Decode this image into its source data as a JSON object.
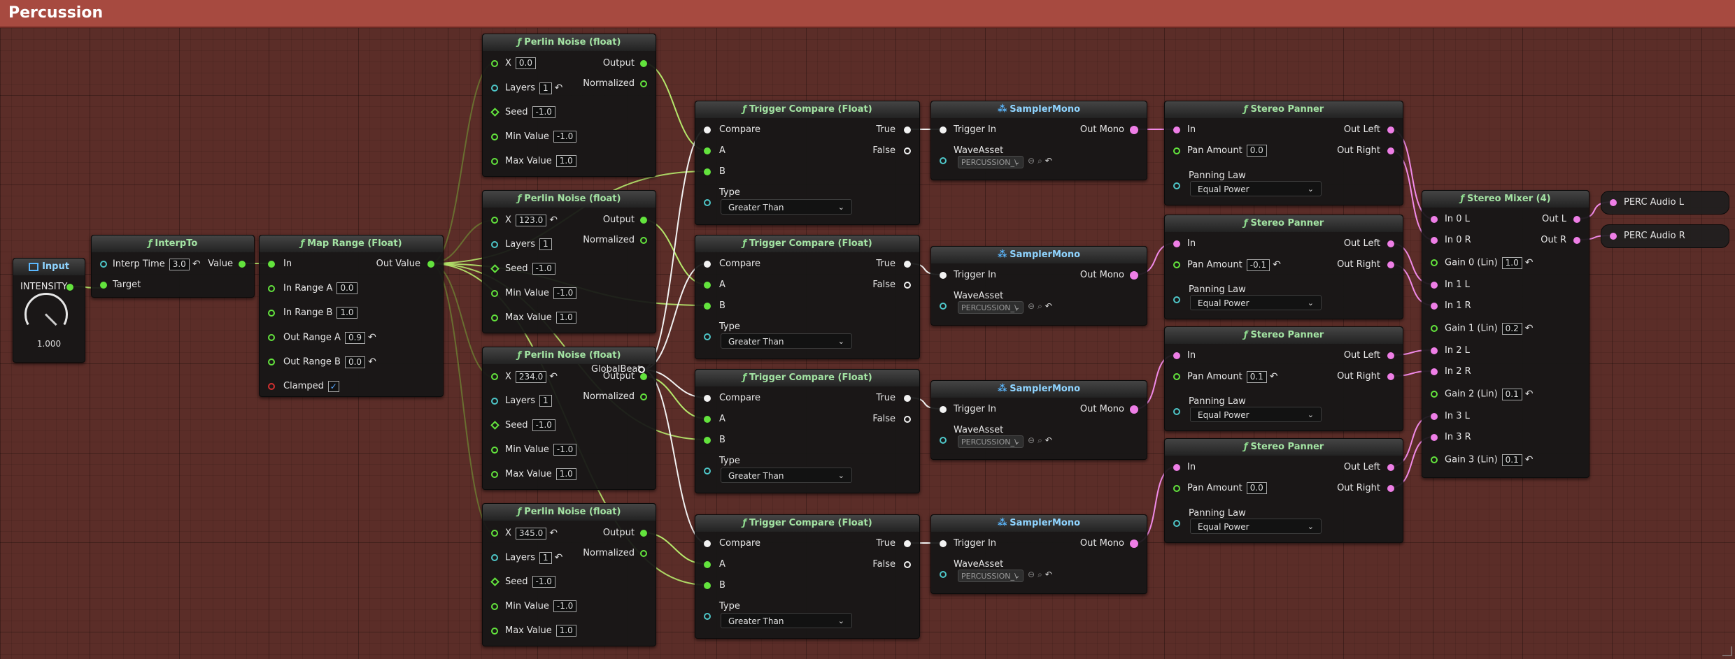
{
  "graph_title": "Percussion",
  "colors": {
    "title_bar": "#a74a40",
    "background": "#5b2d28",
    "float_pin": "#63e33d",
    "audio_pin": "#ee7ee6",
    "trigger_pin": "#f2f2f2"
  },
  "input_node": {
    "title": "Input",
    "pin_label": "INTENSITY",
    "knob_value": "1.000"
  },
  "interp_node": {
    "title": "InterpTo",
    "interp_time_label": "Interp Time",
    "interp_time_value": "3.0",
    "target_label": "Target",
    "value_label": "Value"
  },
  "map_range_node": {
    "title": "Map Range (Float)",
    "in_label": "In",
    "out_label": "Out Value",
    "in_range_a_label": "In Range A",
    "in_range_a": "0.0",
    "in_range_b_label": "In Range B",
    "in_range_b": "1.0",
    "out_range_a_label": "Out Range A",
    "out_range_a": "0.9",
    "out_range_b_label": "Out Range B",
    "out_range_b": "0.0",
    "clamped_label": "Clamped",
    "clamped_check": "✓"
  },
  "perlin_nodes": [
    {
      "title": "Perlin Noise (float)",
      "x_label": "X",
      "x": "0.0",
      "layers_label": "Layers",
      "layers": "1",
      "seed_label": "Seed",
      "seed": "-1.0",
      "min_label": "Min Value",
      "min": "-1.0",
      "max_label": "Max Value",
      "max": "1.0",
      "output_label": "Output",
      "normalized_label": "Normalized"
    },
    {
      "title": "Perlin Noise (float)",
      "x_label": "X",
      "x": "123.0",
      "layers_label": "Layers",
      "layers": "1",
      "seed_label": "Seed",
      "seed": "-1.0",
      "min_label": "Min Value",
      "min": "-1.0",
      "max_label": "Max Value",
      "max": "1.0",
      "output_label": "Output",
      "normalized_label": "Normalized"
    },
    {
      "title": "Perlin Noise (float)",
      "x_label": "X",
      "x": "234.0",
      "layers_label": "Layers",
      "layers": "1",
      "seed_label": "Seed",
      "seed": "-1.0",
      "min_label": "Min Value",
      "min": "-1.0",
      "max_label": "Max Value",
      "max": "1.0",
      "output_label": "Output",
      "normalized_label": "Normalized"
    },
    {
      "title": "Perlin Noise (float)",
      "x_label": "X",
      "x": "345.0",
      "layers_label": "Layers",
      "layers": "1",
      "seed_label": "Seed",
      "seed": "-1.0",
      "min_label": "Min Value",
      "min": "-1.0",
      "max_label": "Max Value",
      "max": "1.0",
      "output_label": "Output",
      "normalized_label": "Normalized"
    }
  ],
  "global_beat_label": "GlobalBeat",
  "trigger_nodes": [
    {
      "title": "Trigger Compare (Float)",
      "compare_label": "Compare",
      "a_label": "A",
      "b_label": "B",
      "type_label": "Type",
      "type_value": "Greater Than",
      "true_label": "True",
      "false_label": "False"
    },
    {
      "title": "Trigger Compare (Float)",
      "compare_label": "Compare",
      "a_label": "A",
      "b_label": "B",
      "type_label": "Type",
      "type_value": "Greater Than",
      "true_label": "True",
      "false_label": "False"
    },
    {
      "title": "Trigger Compare (Float)",
      "compare_label": "Compare",
      "a_label": "A",
      "b_label": "B",
      "type_label": "Type",
      "type_value": "Greater Than",
      "true_label": "True",
      "false_label": "False"
    },
    {
      "title": "Trigger Compare (Float)",
      "compare_label": "Compare",
      "a_label": "A",
      "b_label": "B",
      "type_label": "Type",
      "type_value": "Greater Than",
      "true_label": "True",
      "false_label": "False"
    }
  ],
  "sampler_nodes": [
    {
      "title": "SamplerMono",
      "trigger_label": "Trigger In",
      "out_label": "Out Mono",
      "wave_label": "WaveAsset",
      "wave_value": "PERCUSSION_\\"
    },
    {
      "title": "SamplerMono",
      "trigger_label": "Trigger In",
      "out_label": "Out Mono",
      "wave_label": "WaveAsset",
      "wave_value": "PERCUSSION_\\"
    },
    {
      "title": "SamplerMono",
      "trigger_label": "Trigger In",
      "out_label": "Out Mono",
      "wave_label": "WaveAsset",
      "wave_value": "PERCUSSION_\\"
    },
    {
      "title": "SamplerMono",
      "trigger_label": "Trigger In",
      "out_label": "Out Mono",
      "wave_label": "WaveAsset",
      "wave_value": "PERCUSSION_\\"
    }
  ],
  "panner_nodes": [
    {
      "title": "Stereo Panner",
      "in_label": "In",
      "pan_label": "Pan Amount",
      "pan": "0.0",
      "law_label": "Panning Law",
      "law_value": "Equal Power",
      "out_left_label": "Out Left",
      "out_right_label": "Out Right"
    },
    {
      "title": "Stereo Panner",
      "in_label": "In",
      "pan_label": "Pan Amount",
      "pan": "-0.1",
      "law_label": "Panning Law",
      "law_value": "Equal Power",
      "out_left_label": "Out Left",
      "out_right_label": "Out Right"
    },
    {
      "title": "Stereo Panner",
      "in_label": "In",
      "pan_label": "Pan Amount",
      "pan": "0.1",
      "law_label": "Panning Law",
      "law_value": "Equal Power",
      "out_left_label": "Out Left",
      "out_right_label": "Out Right"
    },
    {
      "title": "Stereo Panner",
      "in_label": "In",
      "pan_label": "Pan Amount",
      "pan": "0.0",
      "law_label": "Panning Law",
      "law_value": "Equal Power",
      "out_left_label": "Out Left",
      "out_right_label": "Out Right"
    }
  ],
  "mixer_node": {
    "title": "Stereo Mixer (4)",
    "in0l": "In 0 L",
    "in0r": "In 0 R",
    "gain0_label": "Gain 0 (Lin)",
    "gain0": "1.0",
    "in1l": "In 1 L",
    "in1r": "In 1 R",
    "gain1_label": "Gain 1 (Lin)",
    "gain1": "0.2",
    "in2l": "In 2 L",
    "in2r": "In 2 R",
    "gain2_label": "Gain 2 (Lin)",
    "gain2": "0.1",
    "in3l": "In 3 L",
    "in3r": "In 3 R",
    "gain3_label": "Gain 3 (Lin)",
    "gain3": "0.1",
    "out_l": "Out L",
    "out_r": "Out R"
  },
  "outputs": {
    "left": "PERC Audio L",
    "right": "PERC Audio R"
  }
}
